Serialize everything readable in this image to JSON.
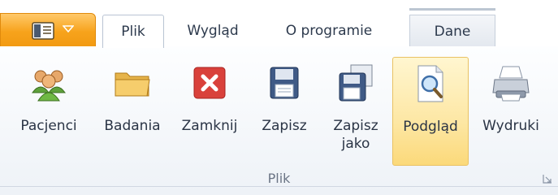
{
  "tabs": [
    {
      "label": "Plik",
      "active": true
    },
    {
      "label": "Wygląd",
      "active": false
    },
    {
      "label": "O programie",
      "active": false
    },
    {
      "label": "Dane",
      "active": false
    }
  ],
  "app_menu": {
    "icon": "app-menu-icon",
    "caret": "chevron-down-icon",
    "color": "#f7a31c"
  },
  "buttons": [
    {
      "label": "Pacjenci",
      "icon": "patients-icon",
      "selected": false
    },
    {
      "label": "Badania",
      "icon": "folder-icon",
      "selected": false
    },
    {
      "label": "Zamknij",
      "icon": "close-icon",
      "selected": false
    },
    {
      "label": "Zapisz",
      "icon": "save-icon",
      "selected": false
    },
    {
      "label": "Zapisz\njako",
      "icon": "save-as-icon",
      "selected": false
    },
    {
      "label": "Podgląd",
      "icon": "preview-icon",
      "selected": true
    },
    {
      "label": "Wydruki",
      "icon": "printer-icon",
      "selected": false
    }
  ],
  "group": {
    "label": "Plik",
    "launcher_icon": "dialog-launcher-icon"
  }
}
